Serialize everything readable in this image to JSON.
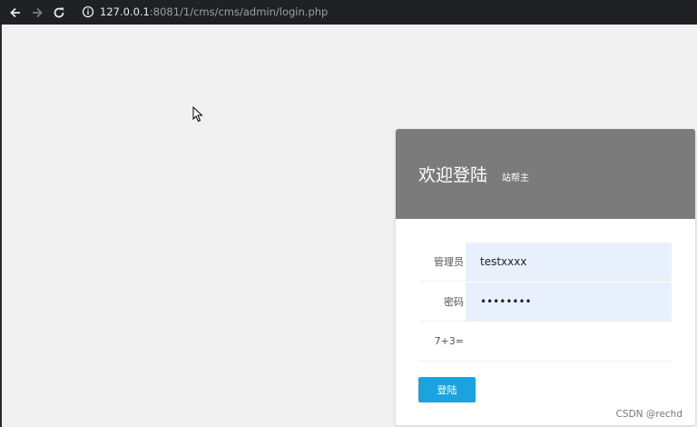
{
  "browser": {
    "url_host": "127.0.0.1",
    "url_rest": ":8081/1/cms/cms/admin/login.php",
    "icons": {
      "back": "arrow-left-icon",
      "forward": "arrow-right-icon",
      "reload": "reload-icon",
      "info": "info-icon"
    }
  },
  "login": {
    "title": "欢迎登陆",
    "subtitle": "站帮主",
    "fields": {
      "username_label": "管理员",
      "username_value": "testxxxx",
      "password_label": "密码",
      "password_value": "testxxxx",
      "captcha_label": "7+3=",
      "captcha_value": ""
    },
    "submit_label": "登陆"
  },
  "watermark": "CSDN @rechd",
  "colors": {
    "header_bg": "#7b7b7b",
    "input_bg": "#e8f0fe",
    "button_bg": "#1aa3de",
    "page_bg": "#f1f1f1"
  }
}
